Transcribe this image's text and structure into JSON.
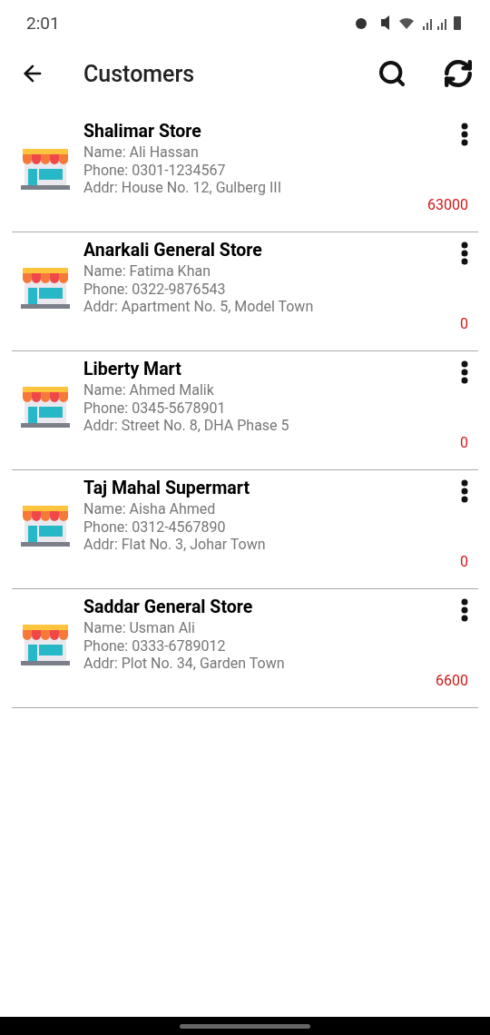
{
  "status_bar": {
    "time": "2:01"
  },
  "app_bar": {
    "title": "Customers"
  },
  "customers": [
    {
      "store": "Shalimar Store",
      "name": "Name: Ali Hassan",
      "phone": "Phone: 0301-1234567",
      "address": "Addr: House No. 12, Gulberg III",
      "balance": "63000"
    },
    {
      "store": "Anarkali General Store",
      "name": "Name: Fatima Khan",
      "phone": "Phone: 0322-9876543",
      "address": "Addr: Apartment No. 5, Model Town",
      "balance": "0"
    },
    {
      "store": "Liberty Mart",
      "name": "Name: Ahmed Malik",
      "phone": "Phone: 0345-5678901",
      "address": "Addr: Street No. 8, DHA Phase 5",
      "balance": "0"
    },
    {
      "store": "Taj Mahal Supermart",
      "name": "Name: Aisha Ahmed",
      "phone": "Phone: 0312-4567890",
      "address": "Addr: Flat No. 3, Johar Town",
      "balance": "0"
    },
    {
      "store": "Saddar General Store",
      "name": "Name: Usman Ali",
      "phone": "Phone: 0333-6789012",
      "address": "Addr: Plot No. 34, Garden Town",
      "balance": "6600"
    }
  ]
}
